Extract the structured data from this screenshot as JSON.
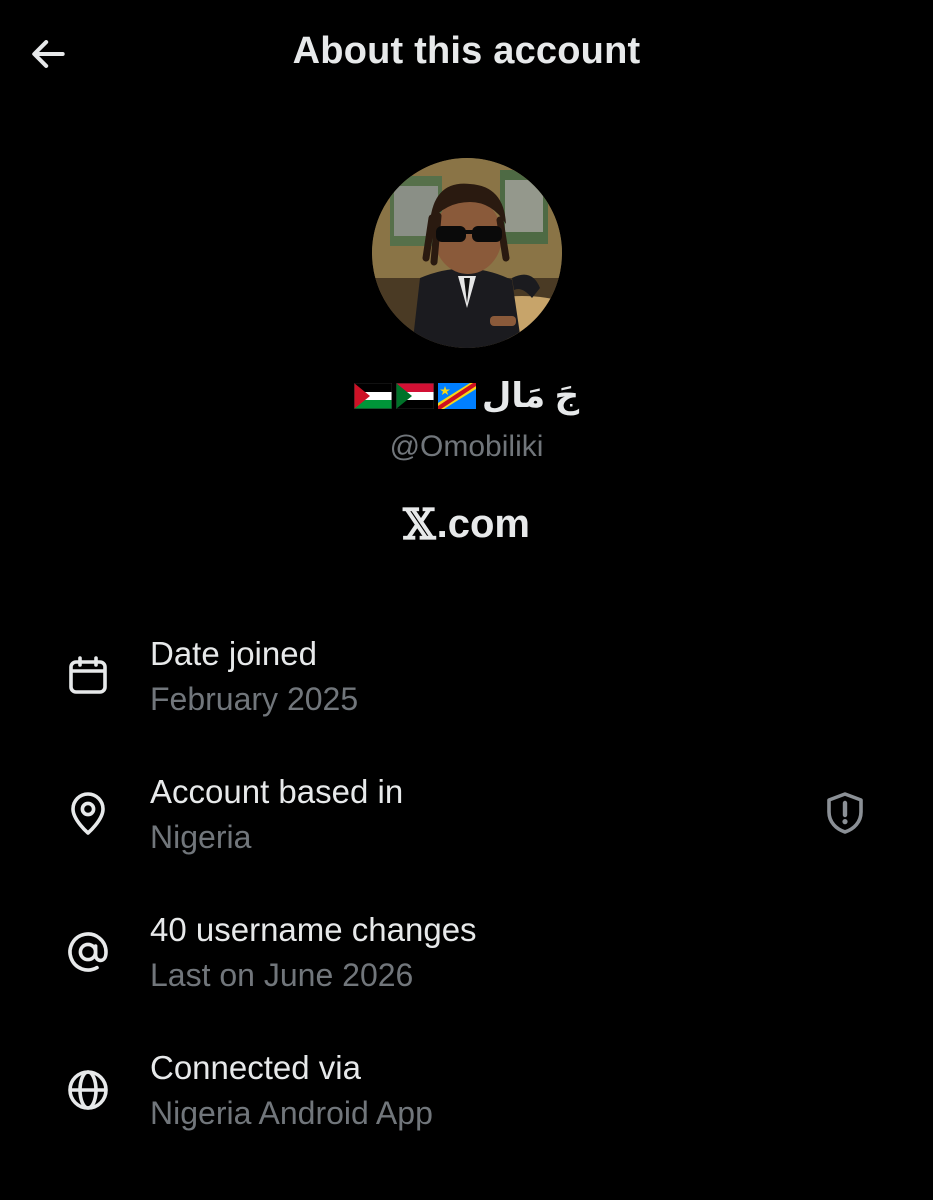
{
  "header": {
    "title": "About this account",
    "back_icon": "arrow-left-icon"
  },
  "profile": {
    "display_name": "جَ مَال",
    "flags": [
      "palestine-flag",
      "sudan-flag",
      "dr-congo-flag"
    ],
    "handle": "@Omobiliki",
    "site_mark": "𝕏",
    "site_suffix": ".com"
  },
  "info": {
    "date_joined": {
      "icon": "calendar-icon",
      "title": "Date joined",
      "value": "February 2025"
    },
    "based_in": {
      "icon": "location-pin-icon",
      "title": "Account based in",
      "value": "Nigeria",
      "action_icon": "shield-alert-icon"
    },
    "username_changes": {
      "icon": "at-sign-icon",
      "title": "40 username changes",
      "value": "Last on June 2026"
    },
    "connected_via": {
      "icon": "globe-icon",
      "title": "Connected via",
      "value": "Nigeria Android App"
    }
  },
  "colors": {
    "background": "#000000",
    "primary_text": "#e7e9ea",
    "secondary_text": "#71767b"
  }
}
